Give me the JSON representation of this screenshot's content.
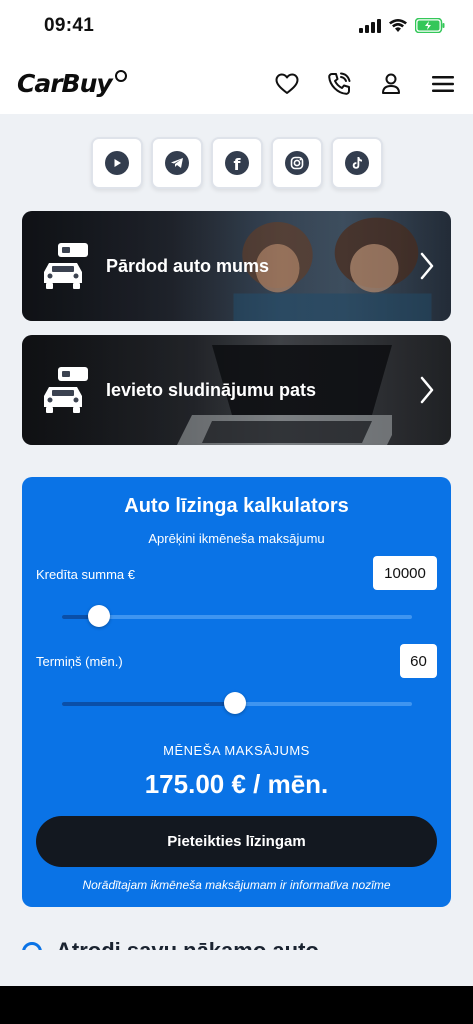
{
  "status_bar": {
    "time": "09:41",
    "icons": [
      "signal-icon",
      "wifi-icon",
      "battery-charging-icon"
    ],
    "battery_color": "#34c759"
  },
  "header": {
    "logo_text": "CarBuy",
    "icons": [
      "heart-icon",
      "phone-icon",
      "user-icon",
      "menu-icon"
    ]
  },
  "socials": [
    "youtube-icon",
    "telegram-icon",
    "facebook-icon",
    "instagram-icon",
    "tiktok-icon"
  ],
  "promos": [
    {
      "label": "Pārdod auto mums",
      "icon": "car-sell-icon"
    },
    {
      "label": "Ievieto sludinājumu pats",
      "icon": "car-listing-icon"
    }
  ],
  "calculator": {
    "title": "Auto līzinga kalkulators",
    "subtitle": "Aprēķini ikmēneša maksājumu",
    "credit_label": "Kredīta summa €",
    "credit_value": "10000",
    "credit_slider_fraction": 0.105,
    "term_label": "Termiņš (mēn.)",
    "term_value": "60",
    "term_slider_fraction": 0.495,
    "payment_label": "MĒNEŠA MAKSĀJUMS",
    "payment_value": "175.00 € / mēn.",
    "apply_button": "Pieteikties līzingam",
    "disclaimer": "Norādītajam ikmēneša maksājumam ir informatīva nozīme",
    "accent_color": "#0a73e6"
  },
  "next_section": {
    "heading": "Atrodi savu nākamo auto"
  }
}
